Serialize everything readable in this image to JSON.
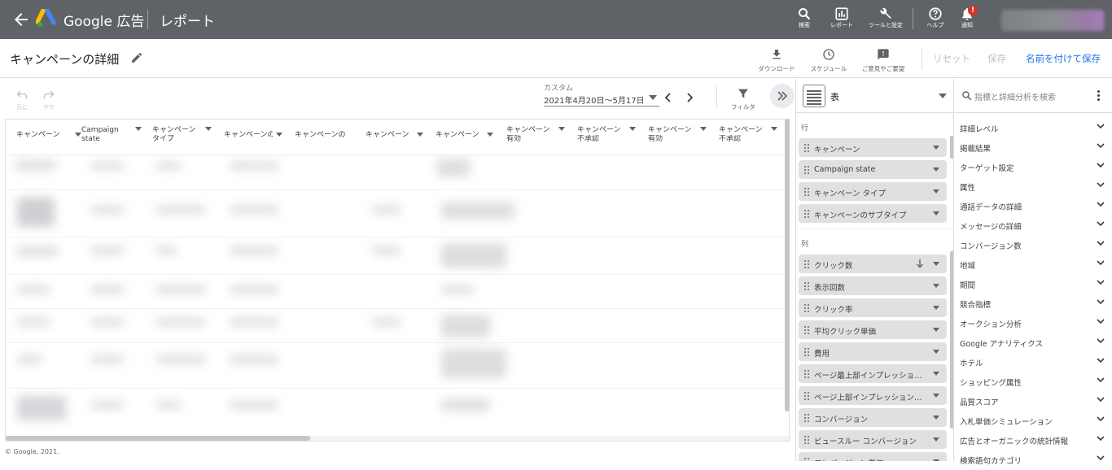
{
  "topbar": {
    "brand": "Google 広告",
    "title": "レポート",
    "icons": [
      {
        "name": "search",
        "label": "検索"
      },
      {
        "name": "reports",
        "label": "レポート"
      },
      {
        "name": "tools",
        "label": "ツールと設定"
      },
      {
        "name": "help",
        "label": "ヘルプ"
      },
      {
        "name": "notifications",
        "label": "通知",
        "badge": "!"
      }
    ]
  },
  "header": {
    "page_title": "キャンペーンの詳細",
    "download": "ダウンロード",
    "schedule": "スケジュール",
    "feedback": "ご意見やご要望",
    "reset": "リセット",
    "save": "保存",
    "save_as": "名前を付けて保存"
  },
  "toolbar": {
    "undo": "元に",
    "redo": "やり",
    "custom_label": "カスタム",
    "date_range": "2021年4月20日〜5月17日",
    "filter": "フィルタ"
  },
  "table": {
    "columns": [
      {
        "l1": "キャンペーン",
        "l2": ""
      },
      {
        "l1": "Campaign",
        "l2": "state"
      },
      {
        "l1": "キャンペーン",
        "l2": "タイプ"
      },
      {
        "l1": "キャンペーンの",
        "l2": ""
      },
      {
        "l1": "キャンペーンの",
        "l2": ""
      },
      {
        "l1": "キャンペーン",
        "l2": ""
      },
      {
        "l1": "キャンペーン",
        "l2": ""
      },
      {
        "l1": "キャンペーン",
        "l2": "有効"
      },
      {
        "l1": "キャンペーン",
        "l2": "不承認"
      },
      {
        "l1": "キャンペーン",
        "l2": "有効"
      },
      {
        "l1": "キャンペーン",
        "l2": "不承認"
      }
    ]
  },
  "footer": "© Google, 2021.",
  "config": {
    "visualization": "表",
    "rows_label": "行",
    "rows": [
      "キャンペーン",
      "Campaign state",
      "キャンペーン タイプ",
      "キャンペーンのサブタイプ"
    ],
    "columns_label": "列",
    "columns": [
      "クリック数",
      "表示回数",
      "クリック率",
      "平均クリック単価",
      "費用",
      "ページ最上部インプレッションの割合",
      "ページ上部インプレッションの割合",
      "コンバージョン",
      "ビュースルー コンバージョン",
      "コンバージョン単価"
    ]
  },
  "fields": {
    "search_placeholder": "指標と詳細分析を検索",
    "categories": [
      "詳細レベル",
      "掲載結果",
      "ターゲット設定",
      "属性",
      "通話データの詳細",
      "メッセージの詳細",
      "コンバージョン数",
      "地域",
      "期間",
      "競合指標",
      "オークション分析",
      "Google アナリティクス",
      "ホテル",
      "ショッピング属性",
      "品質スコア",
      "入札単価シミュレーション",
      "広告とオーガニックの統計情報",
      "検索語句カテゴリ"
    ]
  },
  "colors": {
    "topbar": "#5f6368",
    "accent": "#1a73e8",
    "badge": "#d93025"
  }
}
